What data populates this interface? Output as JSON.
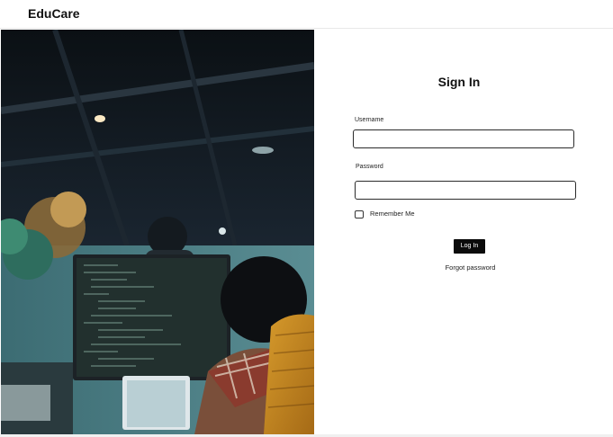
{
  "header": {
    "brand": "EduCare"
  },
  "hero": {
    "image_subject": "person coding at a desk with monitor in dim office"
  },
  "login": {
    "title": "Sign In",
    "username_label": "Username",
    "username_value": "",
    "password_label": "Password",
    "password_value": "",
    "remember_label": "Remember Me",
    "remember_checked": false,
    "login_button": "Log In",
    "forgot_link": "Forgot password"
  },
  "colors": {
    "button_bg": "#0b0b0b",
    "button_text": "#ffffff",
    "page_bg": "#ffffff"
  }
}
